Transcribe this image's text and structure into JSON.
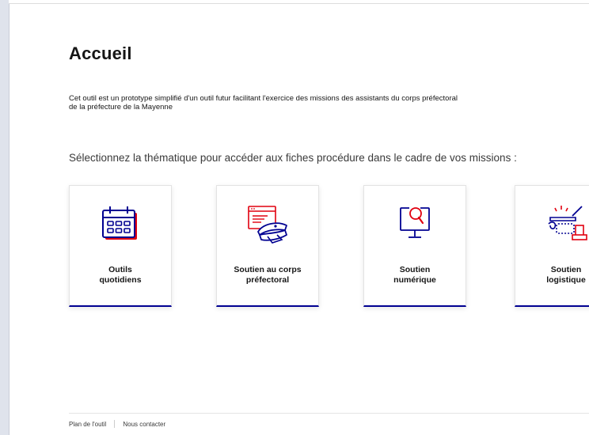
{
  "page": {
    "title": "Accueil",
    "intro_line1": "Cet outil est un prototype simplifié d'un outil futur facilitant l'exercice des missions des assistants du corps préfectoral",
    "intro_line2": "de la préfecture de la Mayenne",
    "lead": "Sélectionnez la thématique pour accéder aux fiches procédure dans le cadre de vos missions :"
  },
  "tiles": [
    {
      "label_line1": "Outils",
      "label_line2": "quotidiens",
      "icon": "calendar-icon"
    },
    {
      "label_line1": "Soutien au corps",
      "label_line2": "préfectoral",
      "icon": "prefect-cap-icon"
    },
    {
      "label_line1": "Soutien",
      "label_line2": "numérique",
      "icon": "computer-search-icon"
    },
    {
      "label_line1": "Soutien",
      "label_line2": "logistique",
      "icon": "logistics-icon"
    }
  ],
  "footer": {
    "links": [
      "Plan de l'outil",
      "Nous contacter"
    ]
  },
  "colors": {
    "accent": "#000091",
    "icon_red": "#e1000f"
  }
}
